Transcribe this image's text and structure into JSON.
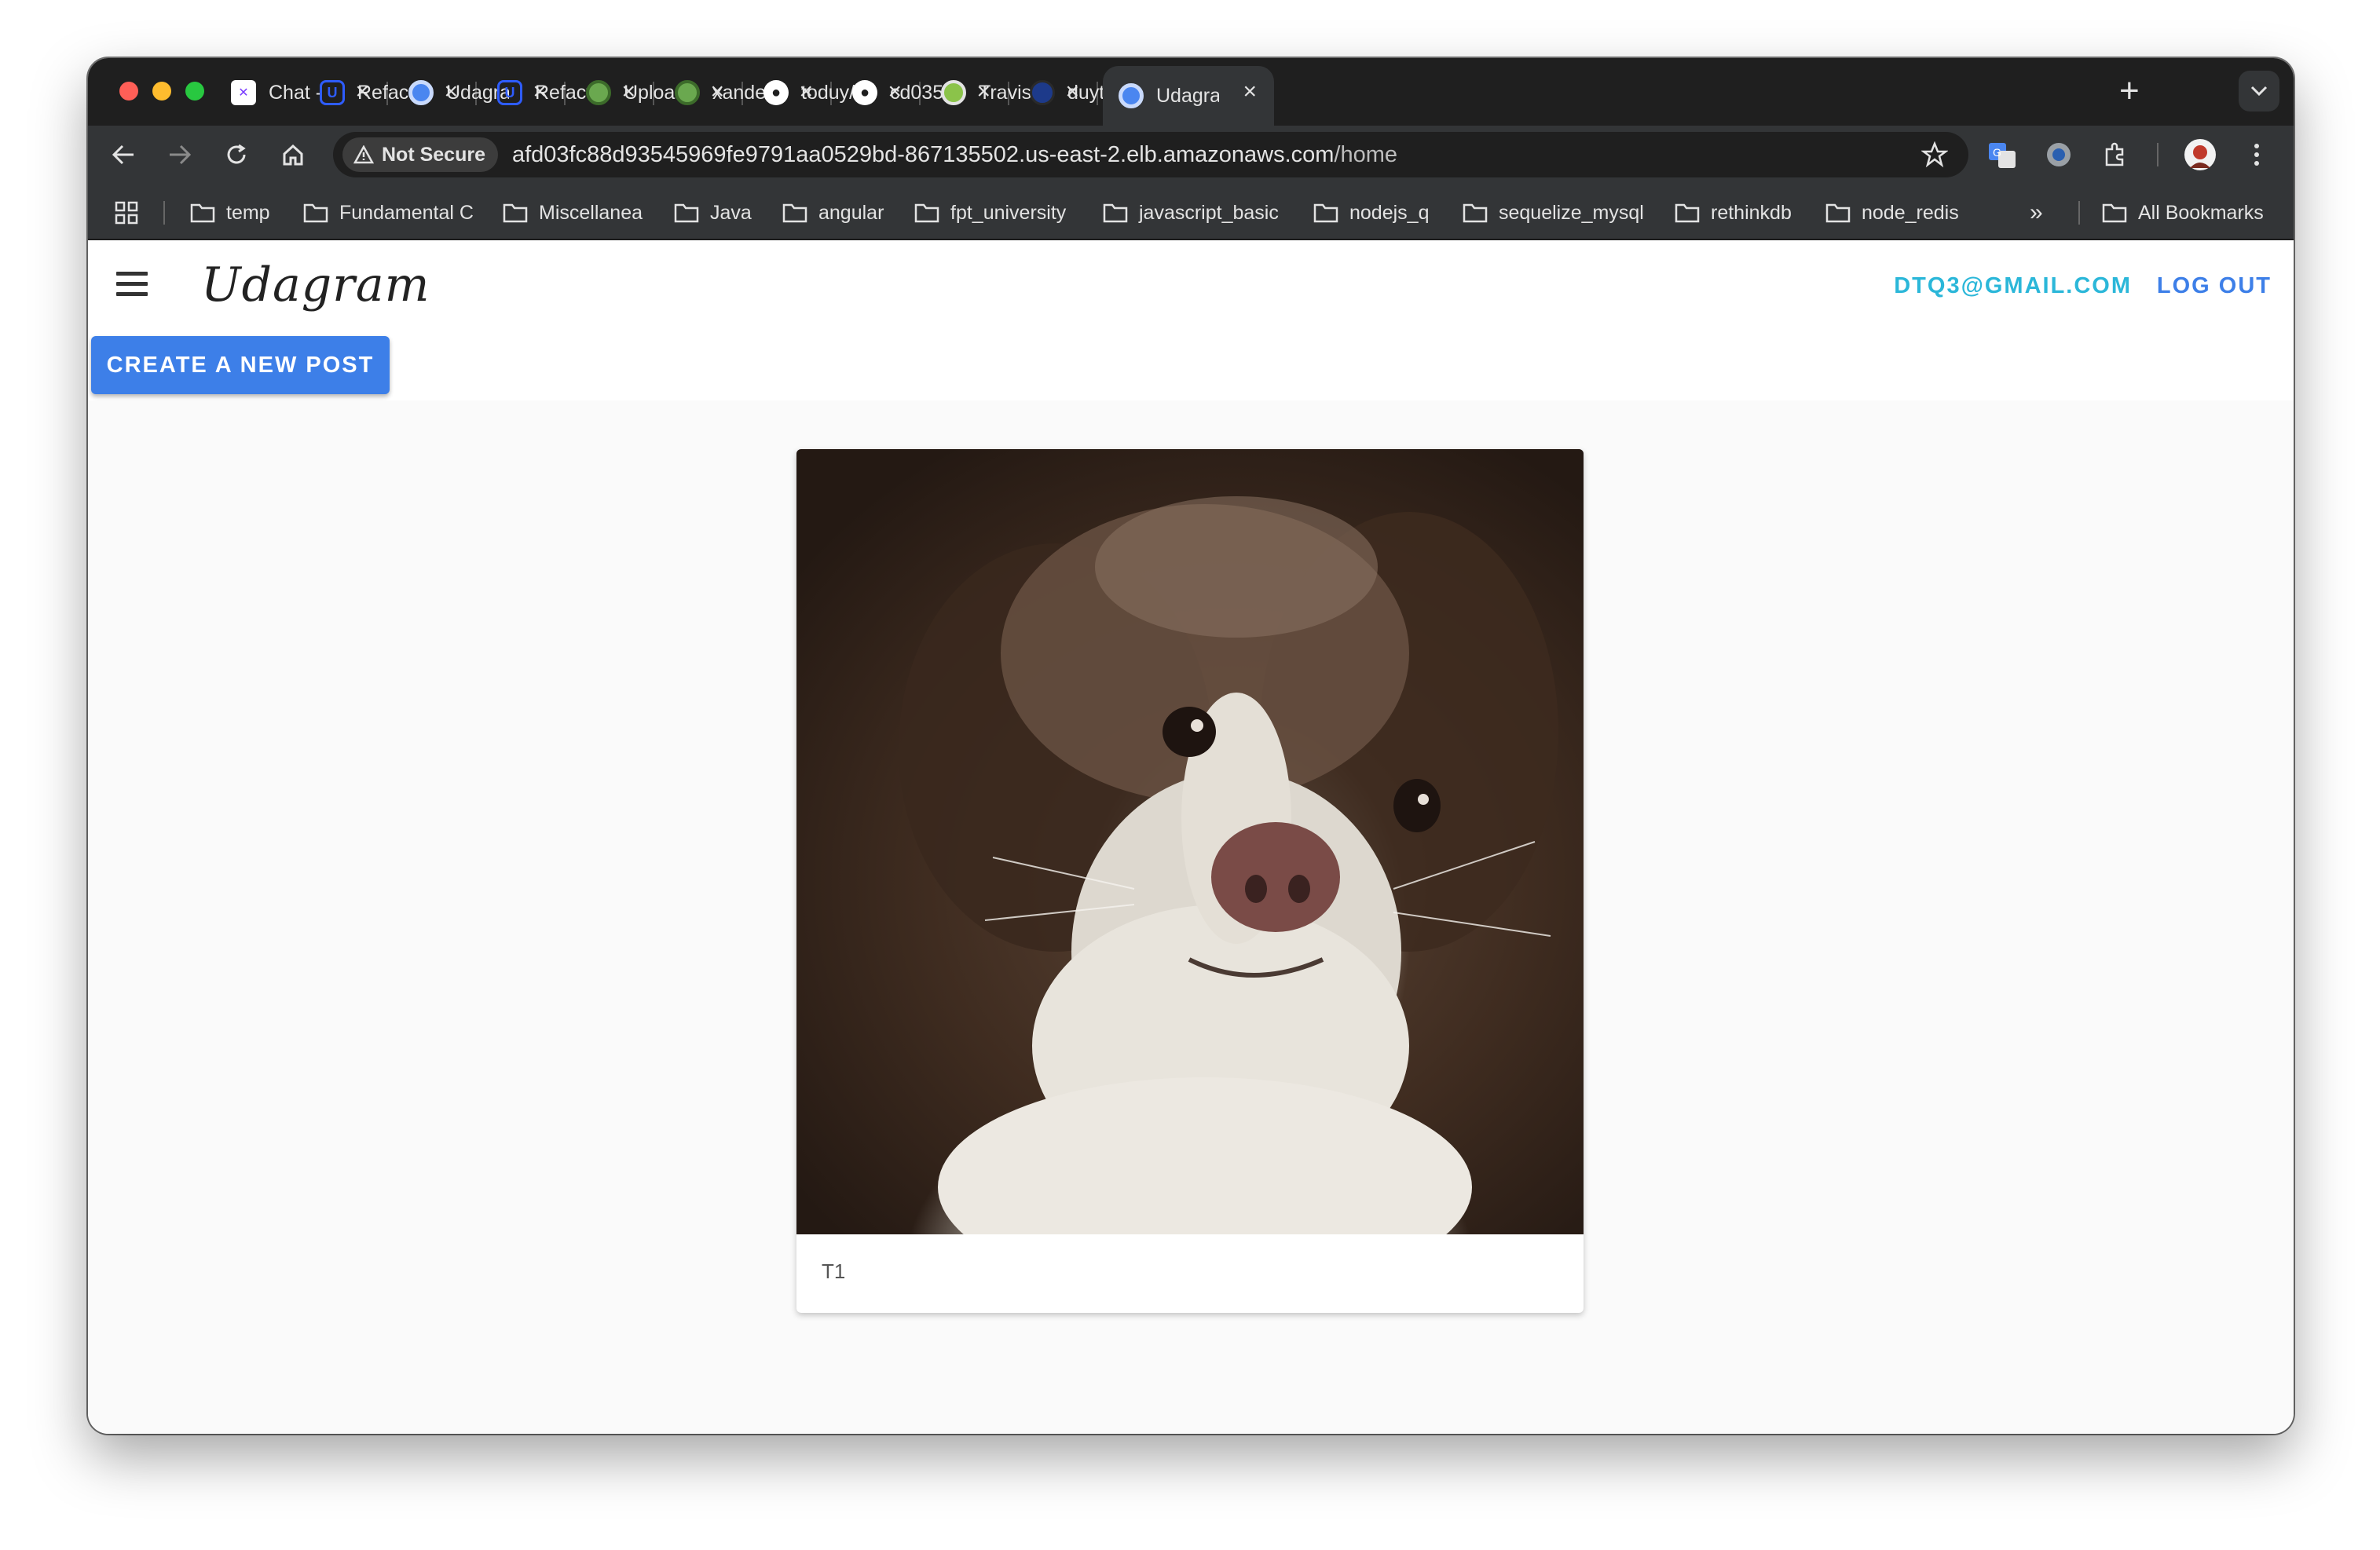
{
  "browser": {
    "tabs": [
      {
        "title": "Chat -",
        "favicon": "chat-favicon",
        "color": "#ffffff"
      },
      {
        "title": "Refactor",
        "favicon": "udacity-favicon",
        "color": "#2e5cff"
      },
      {
        "title": "Udagram",
        "favicon": "chrome-favicon",
        "color": "#4a86f0"
      },
      {
        "title": "Refactor",
        "favicon": "udacity-favicon",
        "color": "#2e5cff"
      },
      {
        "title": "Upload",
        "favicon": "cloud-favicon",
        "color": "#6aa84f"
      },
      {
        "title": "xander",
        "favicon": "cloud-favicon",
        "color": "#6aa84f"
      },
      {
        "title": "toduy/",
        "favicon": "github-favicon",
        "color": "#ffffff"
      },
      {
        "title": "cd035",
        "favicon": "github-favicon",
        "color": "#ffffff"
      },
      {
        "title": "Travis",
        "favicon": "travis-favicon",
        "color": "#8bc34a"
      },
      {
        "title": "duyto/",
        "favicon": "docker-favicon",
        "color": "#1d63ed"
      },
      {
        "title": "Udagram",
        "favicon": "chrome-favicon",
        "color": "#4a86f0",
        "active": true
      }
    ],
    "security_chip": "Not Secure",
    "url_host": "afd03fc88d93545969fe9791aa0529bd-867135502.us-east-2.elb.amazonaws.com",
    "url_path": "/home",
    "bookmarks": [
      "temp",
      "Fundamental C",
      "Miscellanea",
      "Java",
      "angular",
      "fpt_university",
      "javascript_basic",
      "nodejs_q",
      "sequelize_mysql",
      "rethinkdb",
      "node_redis"
    ],
    "bookmarks_overflow": "»",
    "all_bookmarks": "All Bookmarks"
  },
  "app": {
    "logo": "Udagram",
    "user_email": "DTQ3@GMAIL.COM",
    "logout_label": "LOG OUT",
    "create_post_label": "CREATE A NEW POST",
    "posts": [
      {
        "caption": "T1",
        "image": "dog-photo"
      }
    ]
  }
}
